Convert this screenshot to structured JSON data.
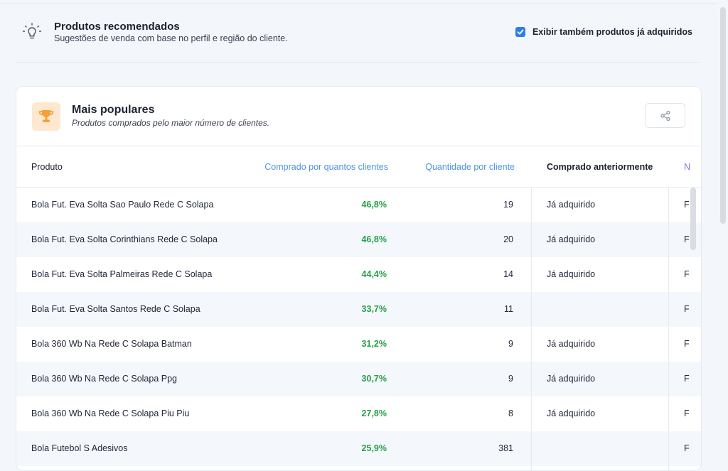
{
  "header": {
    "title": "Produtos recomendados",
    "subtitle": "Sugestões de venda com base no perfil e região do cliente.",
    "show_acquired": {
      "label": "Exibir também produtos já adquiridos",
      "checked": true
    }
  },
  "card": {
    "title": "Mais populares",
    "subtitle": "Produtos comprados pelo maior número de clientes.",
    "icon": "trophy-icon",
    "share_icon": "share-icon"
  },
  "table": {
    "columns": {
      "product": "Produto",
      "pct": "Comprado por quantos clientes",
      "qty": "Quantidade por cliente",
      "previous": "Comprado anteriormente",
      "more": "N"
    },
    "rows": [
      {
        "product": "Bola Fut. Eva Solta Sao Paulo Rede C  Solapa",
        "pct": "46,8%",
        "qty": "19",
        "previous": "Já adquirido",
        "more": "F"
      },
      {
        "product": "Bola Fut. Eva Solta Corinthians Rede C  Solapa",
        "pct": "46,8%",
        "qty": "20",
        "previous": "Já adquirido",
        "more": "F"
      },
      {
        "product": "Bola Fut. Eva Solta Palmeiras Rede C  Solapa",
        "pct": "44,4%",
        "qty": "14",
        "previous": "Já adquirido",
        "more": "F"
      },
      {
        "product": "Bola Fut. Eva Solta Santos Rede C  Solapa",
        "pct": "33,7%",
        "qty": "11",
        "previous": "",
        "more": "F"
      },
      {
        "product": "Bola 360 Wb Na Rede C  Solapa Batman",
        "pct": "31,2%",
        "qty": "9",
        "previous": "Já adquirido",
        "more": "F"
      },
      {
        "product": "Bola 360 Wb Na Rede C  Solapa Ppg",
        "pct": "30,7%",
        "qty": "9",
        "previous": "Já adquirido",
        "more": "F"
      },
      {
        "product": "Bola 360 Wb Na Rede C  Solapa Piu Piu",
        "pct": "27,8%",
        "qty": "8",
        "previous": "Já adquirido",
        "more": "F"
      },
      {
        "product": "Bola Futebol S  Adesivos",
        "pct": "25,9%",
        "qty": "381",
        "previous": "",
        "more": "F"
      }
    ]
  },
  "colors": {
    "accent": "#2f7ee8",
    "pct_green": "#27a046",
    "header_blue": "#4d94e6",
    "trophy": "#f5a03a"
  }
}
